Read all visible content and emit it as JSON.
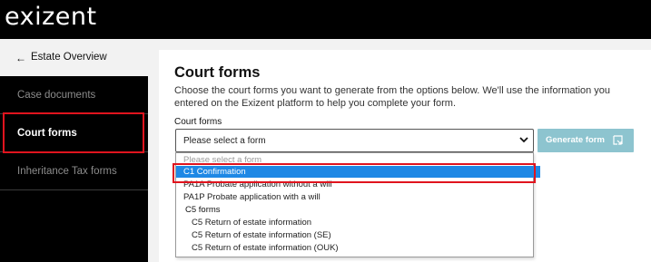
{
  "header": {
    "logo_text": "exizent"
  },
  "nav": {
    "back_arrow": "←",
    "back_label": "Estate Overview",
    "items": [
      {
        "label": "Case documents"
      },
      {
        "label": "Court forms"
      },
      {
        "label": "Inheritance Tax forms"
      }
    ]
  },
  "main": {
    "title": "Court forms",
    "description_line1": "Choose the court forms you want to generate from the options below. We'll use the information you",
    "description_line2": "entered on the Exizent platform to help you complete your form.",
    "field_label": "Court forms",
    "select_value": "Please select a form",
    "generate_label": "Generate form",
    "options": [
      "Please select a form",
      "C1 Confirmation",
      "PA1A Probate application without a will",
      "PA1P Probate application with a will",
      "C5 forms",
      "C5 Return of estate information",
      "C5 Return of estate information (SE)",
      "C5 Return of estate information (OUK)"
    ]
  },
  "colors": {
    "highlight": "#e0141e",
    "selected_option": "#1e88e5",
    "generate_button": "#8dc4cf"
  },
  "icons": [
    "back-arrow-icon",
    "chevron-down-icon",
    "open-external-icon"
  ]
}
